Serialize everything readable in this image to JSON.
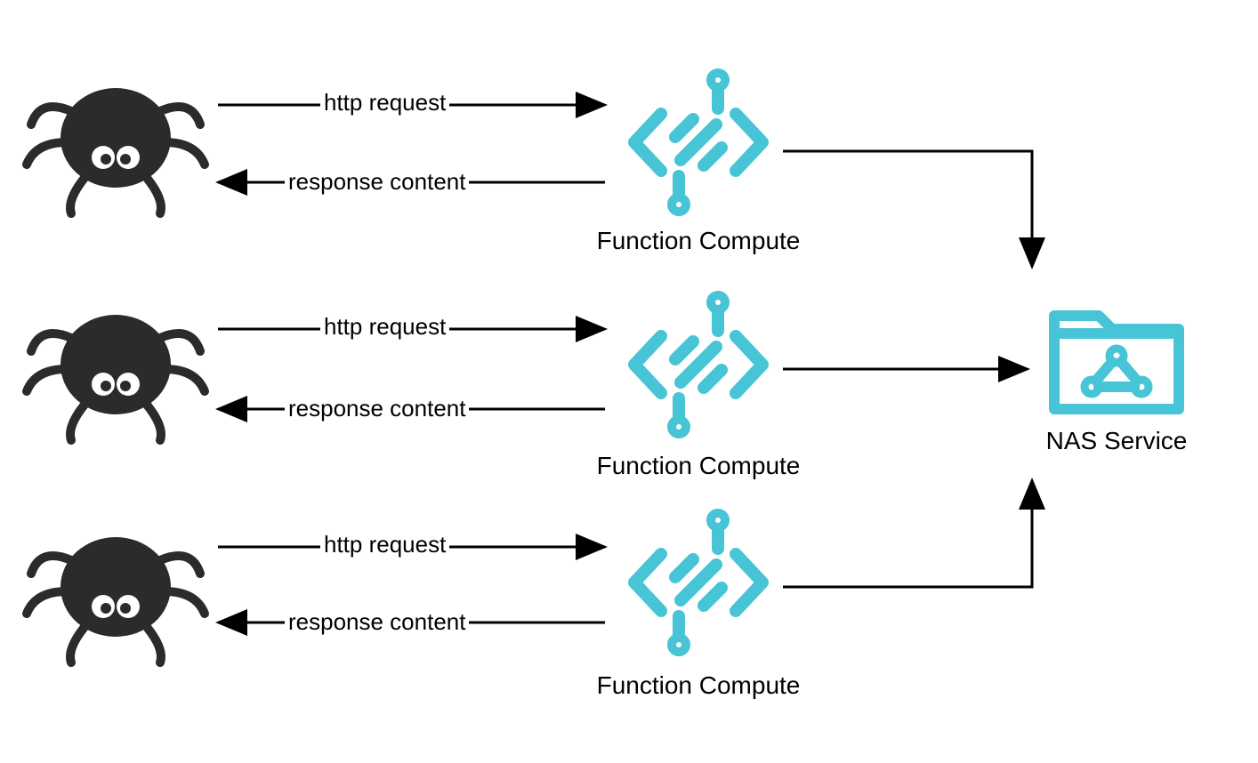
{
  "colors": {
    "spider": "#2b2b2b",
    "function_compute": "#3ec1d3",
    "nas": "#3ec1d3",
    "arrow": "#000000"
  },
  "nodes": {
    "spider1_label": "",
    "spider2_label": "",
    "spider3_label": "",
    "fc1_label": "Function Compute",
    "fc2_label": "Function Compute",
    "fc3_label": "Function Compute",
    "nas_label": "NAS Service"
  },
  "edges": {
    "request_label": "http request",
    "response_label": "response content"
  }
}
